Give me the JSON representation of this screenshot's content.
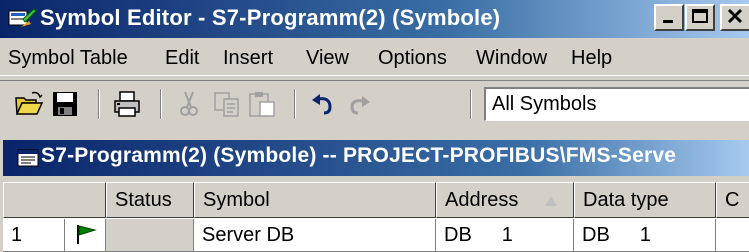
{
  "app": {
    "title": "Symbol Editor - S7-Programm(2) (Symbole)",
    "icon": "symbol-editor-app-icon"
  },
  "menubar": {
    "items": [
      "Symbol Table",
      "Edit",
      "Insert",
      "View",
      "Options",
      "Window",
      "Help"
    ]
  },
  "toolbar": {
    "icons": [
      "open-folder-icon",
      "save-icon",
      "print-icon",
      "cut-icon",
      "copy-icon",
      "paste-icon",
      "undo-icon",
      "redo-icon"
    ],
    "filter": "All Symbols"
  },
  "child_window": {
    "title": "S7-Programm(2) (Symbole) -- PROJECT-PROFIBUS\\FMS-Serve"
  },
  "table": {
    "columns": [
      "Status",
      "Symbol",
      "Address",
      "Data type",
      "C"
    ],
    "rows": [
      {
        "index": "1",
        "status": "",
        "symbol": "Server DB",
        "address": "DB",
        "address_num": "1",
        "data_type": "DB",
        "data_type_num": "1",
        "comment": ""
      }
    ]
  },
  "colors": {
    "title_active": "#0a246a",
    "face": "#d4d0c8",
    "flag_green": "#008000"
  }
}
